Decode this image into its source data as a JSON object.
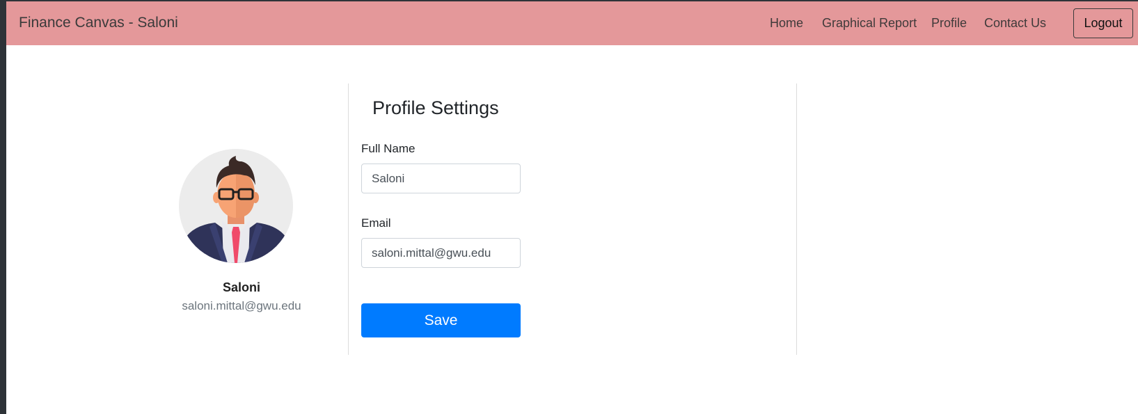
{
  "app": {
    "brand": "Finance Canvas - Saloni"
  },
  "nav": {
    "items": [
      {
        "label": "Home"
      },
      {
        "label": "Graphical Report"
      },
      {
        "label": "Profile"
      },
      {
        "label": "Contact Us"
      }
    ],
    "logout_label": "Logout"
  },
  "sidebar": {
    "name": "Saloni",
    "email": "saloni.mittal@gwu.edu",
    "avatar_icon": "user-avatar-icon"
  },
  "form": {
    "title": "Profile Settings",
    "full_name_label": "Full Name",
    "full_name_value": "Saloni",
    "email_label": "Email",
    "email_value": "saloni.mittal@gwu.edu",
    "save_label": "Save"
  },
  "colors": {
    "navbar": "#e4989a",
    "primary": "#007bff",
    "tie": "#f04a6a",
    "suit": "#2f3359"
  }
}
